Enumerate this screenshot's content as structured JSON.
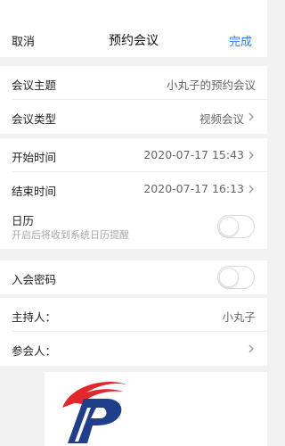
{
  "nav": {
    "cancel_label": "取消",
    "title": "预约会议",
    "done_label": "完成",
    "accent_color": "#2f7cf0"
  },
  "meeting": {
    "topic_label": "会议主题",
    "topic_value": "小丸子的预约会议",
    "type_label": "会议类型",
    "type_value": "视频会议"
  },
  "schedule": {
    "start_label": "开始时间",
    "start_value": "2020-07-17 15:43",
    "end_label": "结束时间",
    "end_value": "2020-07-17 16:13",
    "calendar_label": "日历",
    "calendar_hint": "开启后将收到系统日历提醒",
    "calendar_enabled": false
  },
  "security": {
    "password_label": "入会密码",
    "password_enabled": false
  },
  "people": {
    "host_label": "主持人：",
    "host_value": "小丸子",
    "participants_label": "参会人："
  },
  "icons": {
    "chevron": "chevron-right-icon",
    "logo": "brand-logo-icon"
  }
}
